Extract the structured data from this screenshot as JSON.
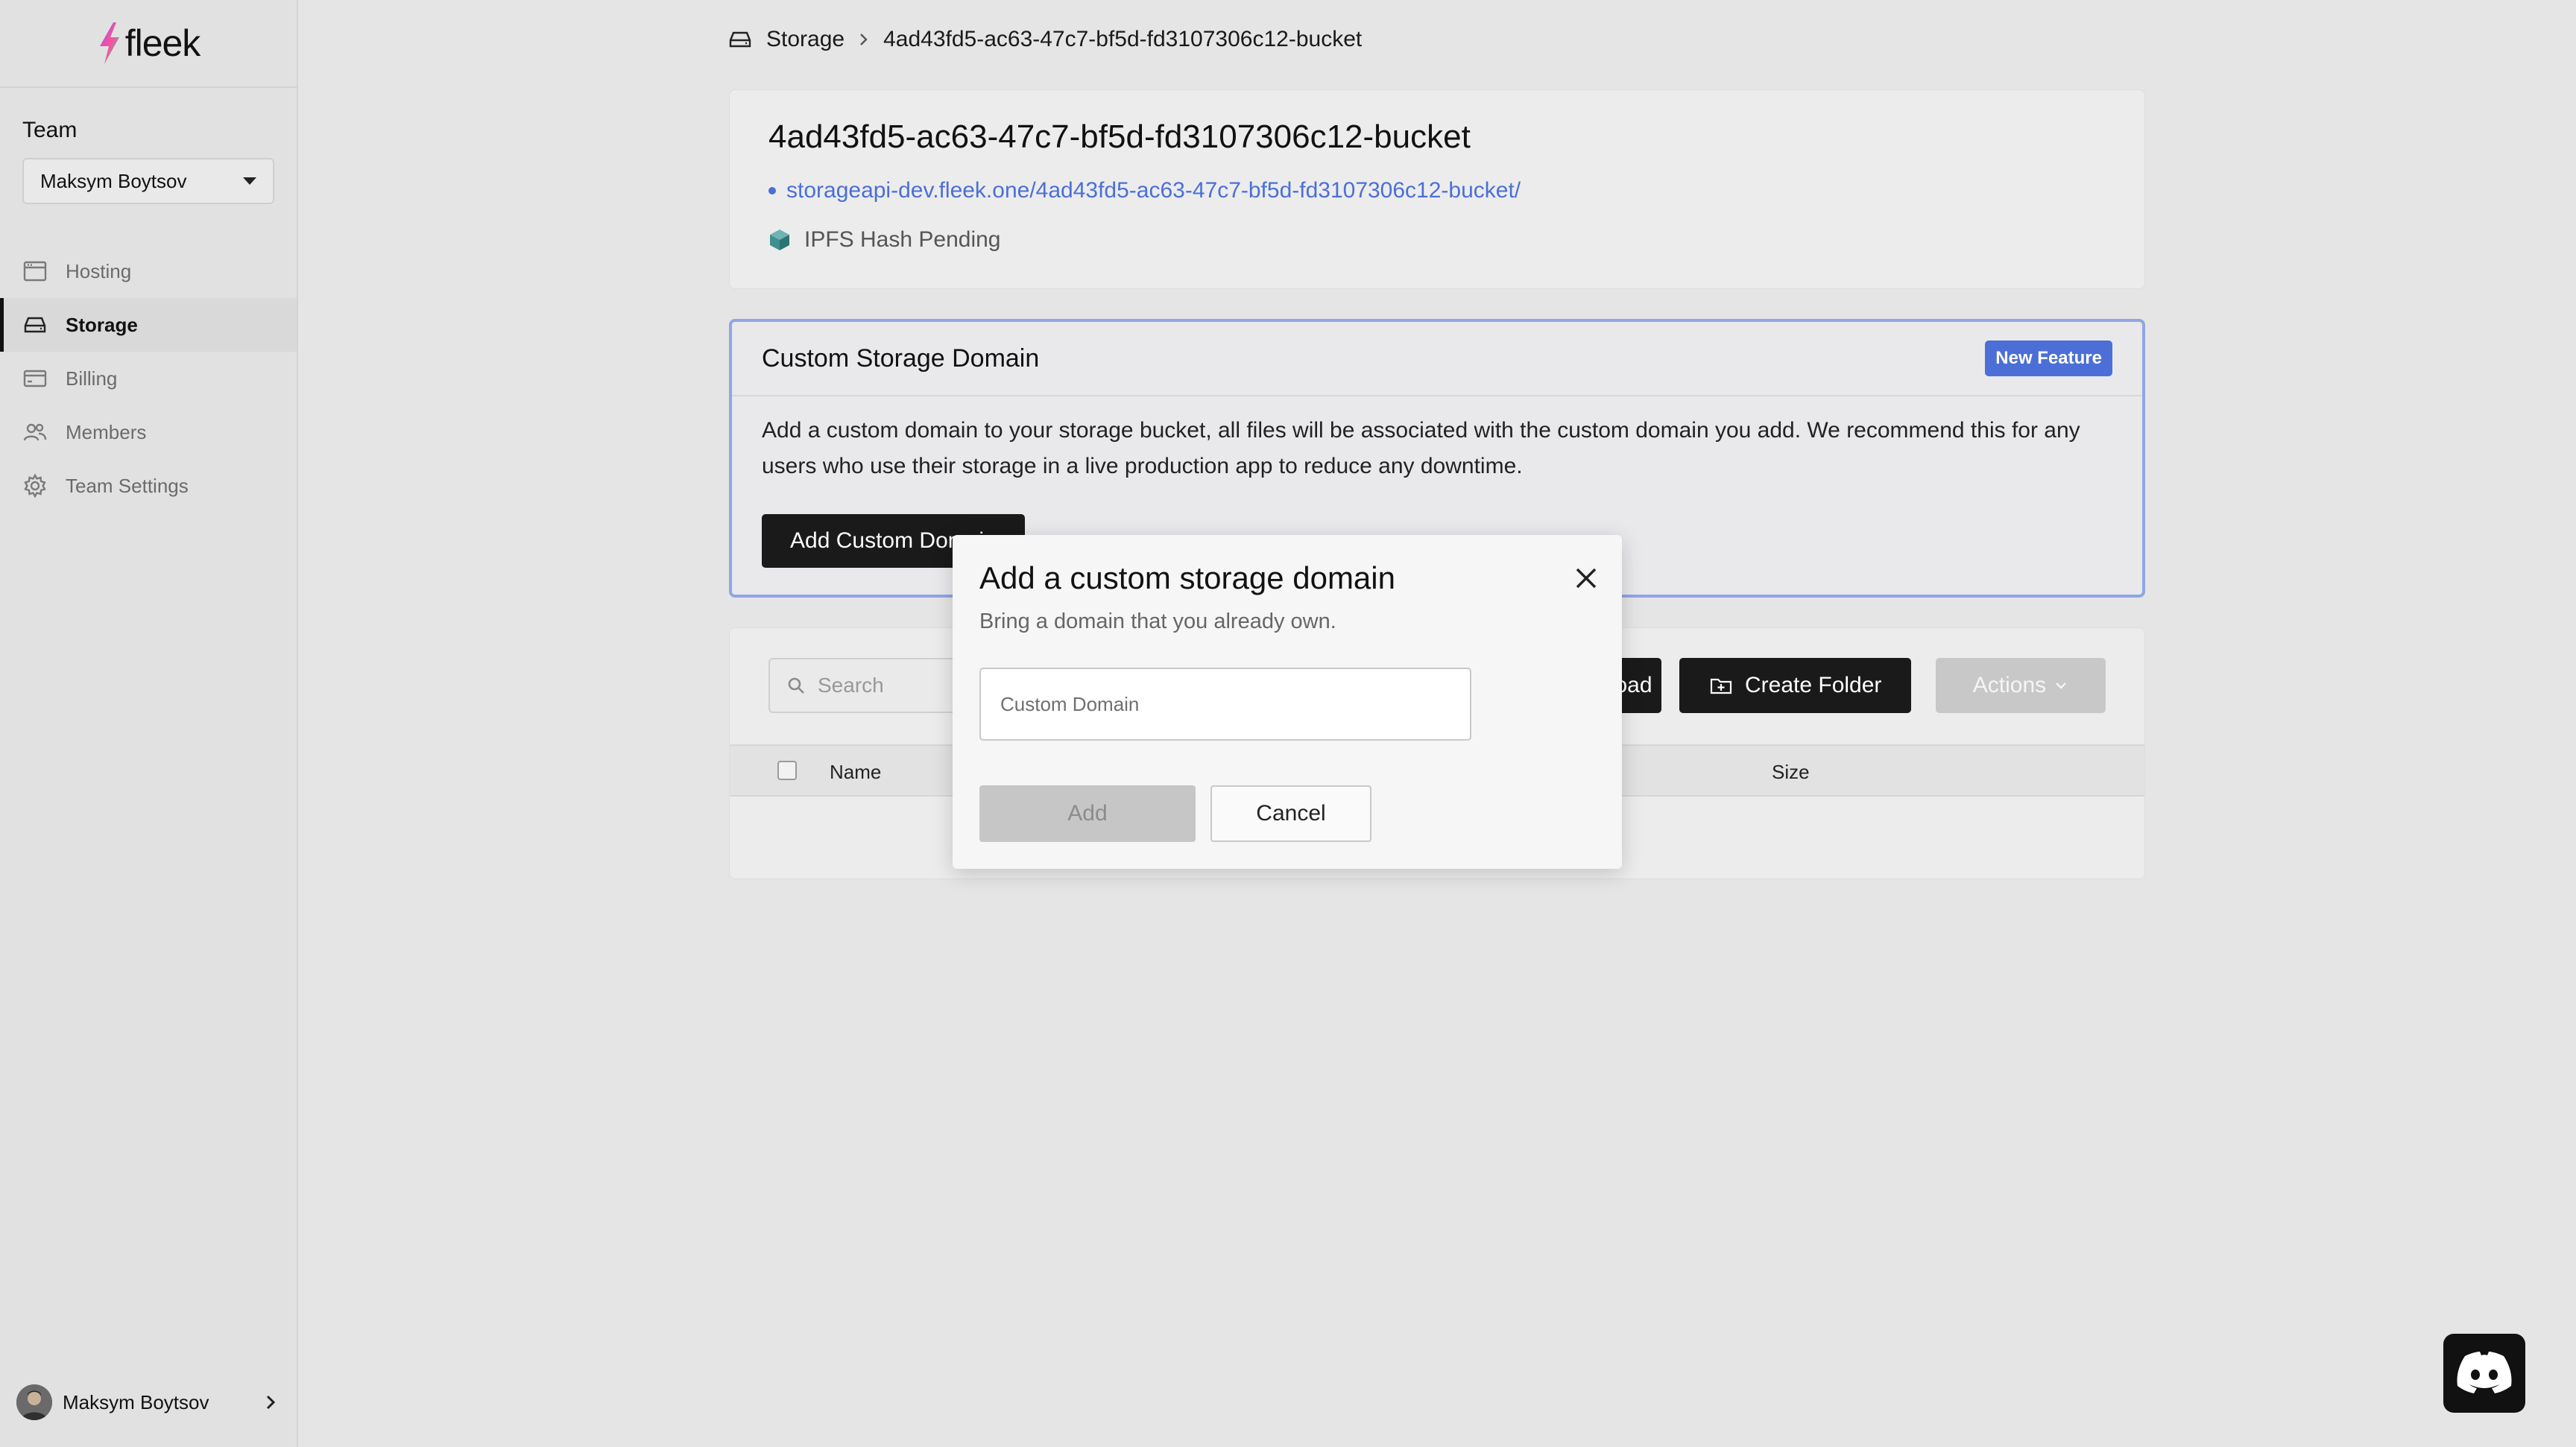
{
  "app": {
    "logo_text": "fleek"
  },
  "sidebar": {
    "team_label": "Team",
    "team_select": "Maksym Boytsov",
    "items": [
      {
        "label": "Hosting",
        "icon": "browser-window-icon",
        "active": false
      },
      {
        "label": "Storage",
        "icon": "drive-icon",
        "active": true
      },
      {
        "label": "Billing",
        "icon": "credit-card-icon",
        "active": false
      },
      {
        "label": "Members",
        "icon": "people-icon",
        "active": false
      },
      {
        "label": "Team Settings",
        "icon": "gear-icon",
        "active": false
      }
    ],
    "user_name": "Maksym Boytsov"
  },
  "breadcrumb": {
    "root": "Storage",
    "current": "4ad43fd5-ac63-47c7-bf5d-fd3107306c12-bucket"
  },
  "bucket": {
    "title": "4ad43fd5-ac63-47c7-bf5d-fd3107306c12-bucket",
    "url": "storageapi-dev.fleek.one/4ad43fd5-ac63-47c7-bf5d-fd3107306c12-bucket/",
    "ipfs_status": "IPFS Hash Pending"
  },
  "custom_domain": {
    "title": "Custom Storage Domain",
    "badge": "New Feature",
    "description": "Add a custom domain to your storage bucket, all files will be associated with the custom domain you add. We recommend this for any users who use their storage in a live production app to reduce any downtime.",
    "button": "Add Custom Domain"
  },
  "files": {
    "search_placeholder": "Search",
    "upload_button": "Upload",
    "create_folder_button": "Create Folder",
    "actions_button": "Actions",
    "columns": {
      "name": "Name",
      "size": "Size"
    }
  },
  "dialog": {
    "title": "Add a custom storage domain",
    "subtitle": "Bring a domain that you already own.",
    "input_placeholder": "Custom Domain",
    "input_value": "",
    "add_button": "Add",
    "cancel_button": "Cancel"
  },
  "colors": {
    "accent": "#4b6fd6",
    "primary_button": "#1a1a1a",
    "background": "#e5e5e5"
  }
}
